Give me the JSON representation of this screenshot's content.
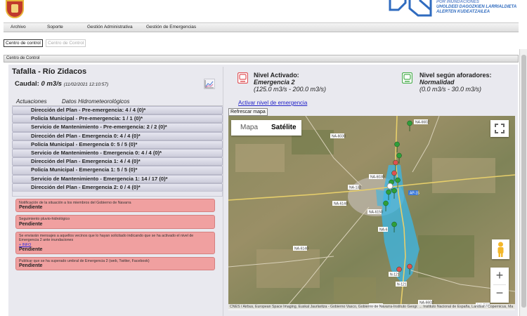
{
  "header": {
    "org_lines": [
      "UHOLDEEI DAGOZKIEN LARRIALDIETA",
      "ALERTEN KUDEATZAILEA"
    ],
    "org_top": "POR INUNDACIONES"
  },
  "menu": [
    "Archivo",
    "Soporte",
    "Gestión Administrativa",
    "Gestión de Emergencias"
  ],
  "tabs": {
    "active": "Centro de control",
    "inactive": "Centro de Control"
  },
  "section_title": "Centro de Control",
  "left": {
    "title": "Tafalla - Río Zidacos",
    "caudal_label": "Caudal:",
    "caudal_value": "0 m3/s",
    "caudal_time": "(11/02/2021 12:10:57)",
    "tab_actuaciones": "Actuaciones",
    "tab_datos": "Datos Hidrometeorológicos",
    "rows": [
      "Dirección del Plan - Pre-emergencia: 4 / 4 (0)*",
      "Policía Municipal - Pre-emergencia: 1 / 1 (0)*",
      "Servicio de Mantenimiento - Pre-emergencia: 2 / 2 (0)*",
      "Dirección del Plan - Emergencia 0: 4 / 4 (0)*",
      "Policía Municipal - Emergencia 0: 5 / 5 (0)*",
      "Servicio de Mantenimiento - Emergencia 0: 4 / 4 (0)*",
      "Dirección del Plan - Emergencia 1: 4 / 4 (0)*",
      "Policía Municipal - Emergencia 1: 5 / 5 (0)*",
      "Servicio de Mantenimiento - Emergencia 1: 14 / 17 (0)*",
      "Dirección del Plan - Emergencia 2: 0 / 4 (0)*"
    ],
    "tasks": [
      {
        "desc": "Notificación de la situación a los miembros del Gobierno de Navarra",
        "link": "",
        "status": "Pendiente"
      },
      {
        "desc": "Seguimiento pluvio-hidrológico",
        "link": "",
        "status": "Pendiente"
      },
      {
        "desc": "Se enviarán mensajes a aquellos vecinos que lo hayan solicitado indicando que se ha activado el nivel de Emergencia 2 ante inundaciones",
        "link": "+ INFO",
        "status": "Pendiente"
      },
      {
        "desc": "Publicar que se ha superado umbral de Emergencia 2 (web, Twitter, Facebook)",
        "link": "",
        "status": "Pendiente"
      }
    ]
  },
  "right": {
    "nivel_activado_label": "Nivel Activado:",
    "nivel_activado_value": "Emergencia 2",
    "nivel_activado_range": "(125.0 m3/s - 200.0 m3/s)",
    "nivel_aforadores_label": "Nivel según aforadores:",
    "nivel_aforadores_value": "Normalidad",
    "nivel_aforadores_range": "(0.0 m3/s - 30.0 m3/s)",
    "activar_link": "Activar nivel de emergencia",
    "refresh_button": "Refrescar mapa",
    "activated_color": "#e0555a",
    "normal_color": "#4caf50"
  },
  "map": {
    "tab_map": "Mapa",
    "tab_satellite": "Satélite",
    "selected_tab": "Satélite",
    "roads": [
      "NA-6020",
      "NA-6030",
      "NA-132",
      "NA-6140",
      "NA-6150",
      "AP-15",
      "NA-6602",
      "N-121",
      "NA-5300",
      "NA-6040"
    ],
    "attribution": "CNES / Airbus, European Space Imaging, Euskal Jaurlaritza - Gobierno Vasco, Gobierno de Navarra-Instituto Geogr. ... Instituto Nacional de España, Landsat / Copernicus, Ma"
  }
}
